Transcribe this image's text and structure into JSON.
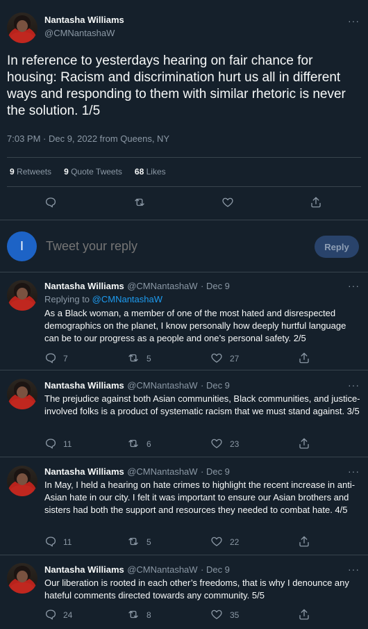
{
  "main_tweet": {
    "author_name": "Nantasha Williams",
    "author_handle": "@CMNantashaW",
    "text": "In reference to yesterdays hearing on fair chance for housing: Racism and discrimination hurt us all in different ways and responding to them with similar rhetoric is never the solution. 1/5",
    "timestamp": "7:03 PM · Dec 9, 2022 from Queens, NY",
    "stats": {
      "retweets_count": "9",
      "retweets_label": "Retweets",
      "quote_count": "9",
      "quote_label": "Quote Tweets",
      "likes_count": "68",
      "likes_label": "Likes"
    },
    "more_label": "···"
  },
  "reply_composer": {
    "avatar_initial": "I",
    "placeholder": "Tweet your reply",
    "button_label": "Reply"
  },
  "replies": [
    {
      "author_name": "Nantasha Williams",
      "author_handle": "@CMNantashaW",
      "date": "· Dec 9",
      "replying_prefix": "Replying to",
      "replying_to": "@CMNantashaW",
      "text": "As a Black woman, a member of one of the most hated and disrespected demographics on the planet, I know personally how deeply hurtful language can be to our progress as a people and one’s personal safety. 2/5",
      "reply_count": "7",
      "retweet_count": "5",
      "like_count": "27"
    },
    {
      "author_name": "Nantasha Williams",
      "author_handle": "@CMNantashaW",
      "date": "· Dec 9",
      "text": "The prejudice against both Asian communities, Black communities, and justice-involved folks is a product of systematic racism that we must stand against. 3/5",
      "reply_count": "11",
      "retweet_count": "6",
      "like_count": "23"
    },
    {
      "author_name": "Nantasha Williams",
      "author_handle": "@CMNantashaW",
      "date": "· Dec 9",
      "text": "In May, I held a hearing on hate crimes to highlight the recent increase in anti-Asian hate in our city. I felt it was important to ensure our Asian brothers and sisters had both the support and resources they needed to combat hate. 4/5",
      "reply_count": "11",
      "retweet_count": "5",
      "like_count": "22"
    },
    {
      "author_name": "Nantasha Williams",
      "author_handle": "@CMNantashaW",
      "date": "· Dec 9",
      "text": "Our liberation is rooted in each other’s freedoms, that is why I denounce any hateful comments directed towards any community. 5/5",
      "reply_count": "24",
      "retweet_count": "8",
      "like_count": "35"
    }
  ],
  "icons": {
    "reply": "reply-icon",
    "retweet": "retweet-icon",
    "like": "heart-icon",
    "share": "share-icon"
  },
  "colors": {
    "background": "#15202b",
    "link": "#1d9bf0",
    "muted": "#8b98a5",
    "reply_button": "#29436b"
  }
}
